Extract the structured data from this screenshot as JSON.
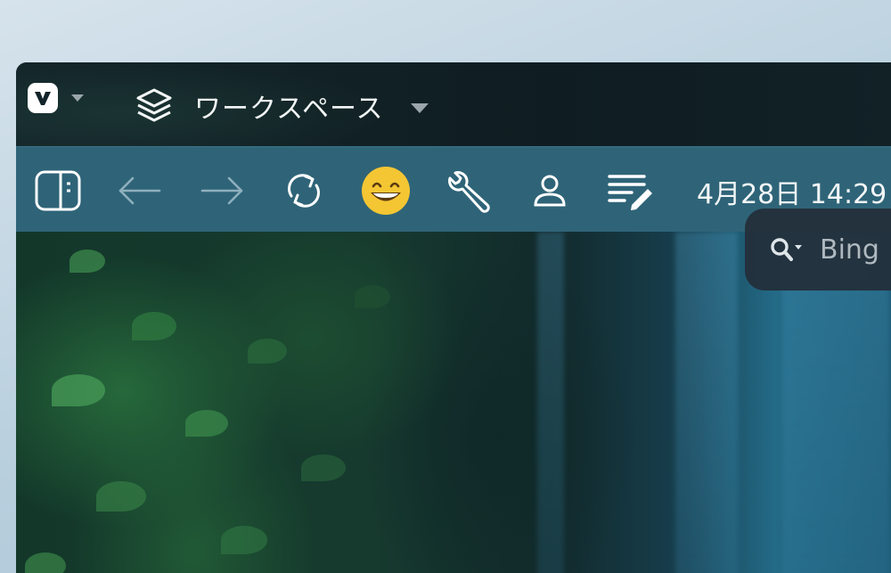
{
  "titlebar": {
    "workspace_label": "ワークスペース",
    "icons": {
      "logo": "vivaldi-logo-icon",
      "menu": "chevron-down-icon",
      "workspace": "layers-icon",
      "workspace_dropdown": "chevron-down-icon"
    }
  },
  "toolbar": {
    "buttons": [
      {
        "name": "panel-toggle",
        "icon": "sidebar-panel-icon"
      },
      {
        "name": "back",
        "icon": "arrow-left-icon"
      },
      {
        "name": "forward",
        "icon": "arrow-right-icon"
      },
      {
        "name": "reload",
        "icon": "reload-icon"
      },
      {
        "name": "emoji",
        "icon": "grinning-face-icon"
      },
      {
        "name": "tools",
        "icon": "wrench-icon"
      },
      {
        "name": "profile",
        "icon": "user-icon"
      },
      {
        "name": "notes",
        "icon": "notes-edit-icon"
      }
    ],
    "clock": "4月28日 14:29"
  },
  "content": {
    "search_placeholder": "Bing"
  },
  "colors": {
    "titlebar": "#12232a",
    "toolbar": "#2f6478",
    "search_bg": "#232e38",
    "emoji_yellow": "#f5c633"
  }
}
